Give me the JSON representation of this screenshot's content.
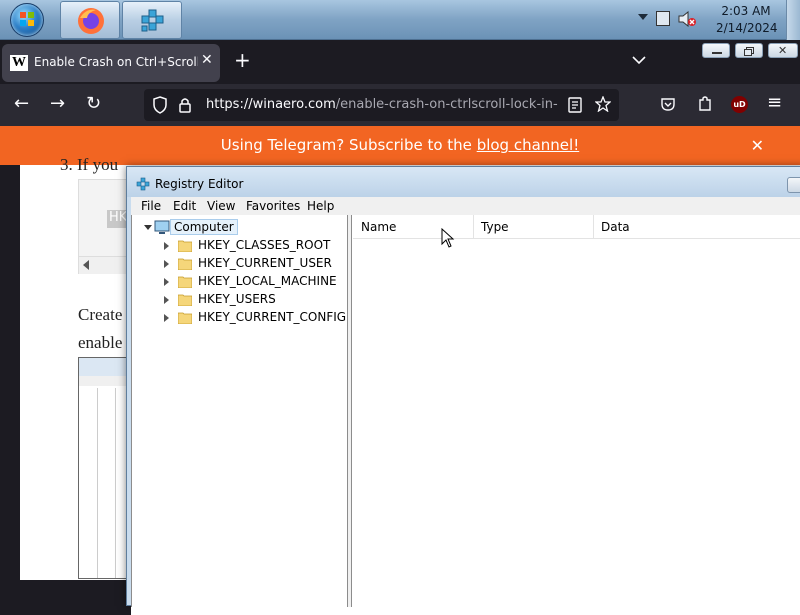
{
  "taskbar": {
    "clock_time": "2:03 AM",
    "clock_date": "2/14/2024"
  },
  "browser": {
    "tab_title": "Enable Crash on Ctrl+Scroll Lock",
    "tab_favicon": "W",
    "url_host": "https://winaero.com",
    "url_path": "/enable-crash-on-ctrlscroll-lock-in-win",
    "ublock_badge": "uD"
  },
  "banner": {
    "text": "Using Telegram? Subscribe to the ",
    "link": "blog channel!",
    "close": "✕"
  },
  "article": {
    "step_fragment": "3. If you",
    "code_fragment": "HK",
    "line1_fragment": "Create",
    "line2_fragment": "enable"
  },
  "regedit": {
    "title": "Registry Editor",
    "menu": [
      "File",
      "Edit",
      "View",
      "Favorites",
      "Help"
    ],
    "tree_root": "Computer",
    "hives": [
      "HKEY_CLASSES_ROOT",
      "HKEY_CURRENT_USER",
      "HKEY_LOCAL_MACHINE",
      "HKEY_USERS",
      "HKEY_CURRENT_CONFIG"
    ],
    "columns": [
      "Name",
      "Type",
      "Data"
    ]
  },
  "colors": {
    "banner_bg": "#f26522",
    "browser_dark": "#1c1b22",
    "toolbar": "#2b2a33"
  }
}
